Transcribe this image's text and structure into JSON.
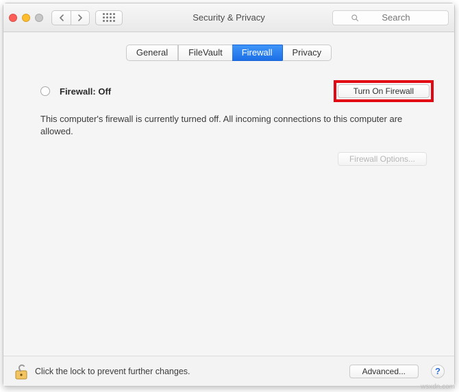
{
  "header": {
    "title": "Security & Privacy",
    "search_placeholder": "Search"
  },
  "tabs": [
    {
      "label": "General"
    },
    {
      "label": "FileVault"
    },
    {
      "label": "Firewall",
      "active": true
    },
    {
      "label": "Privacy"
    }
  ],
  "firewall": {
    "status_label": "Firewall: Off",
    "turn_on_label": "Turn On Firewall",
    "description": "This computer's firewall is currently turned off. All incoming connections to this computer are allowed.",
    "options_label": "Firewall Options..."
  },
  "footer": {
    "lock_text": "Click the lock to prevent further changes.",
    "advanced_label": "Advanced...",
    "help_label": "?"
  },
  "watermark": "wsxdn.com"
}
